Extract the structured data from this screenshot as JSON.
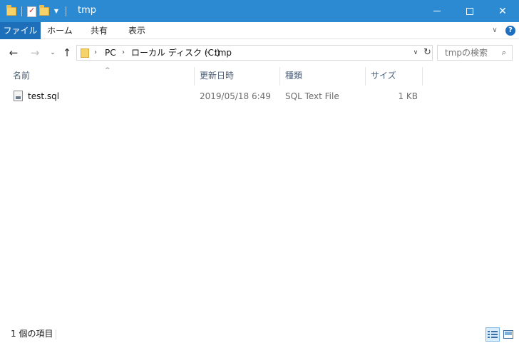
{
  "window": {
    "title": "tmp",
    "minimize_icon": "minimize-icon",
    "maximize_icon": "maximize-icon",
    "close_glyph": "✕"
  },
  "ribbon": {
    "tabs": [
      {
        "label": "ファイル"
      },
      {
        "label": "ホーム"
      },
      {
        "label": "共有"
      },
      {
        "label": "表示"
      }
    ],
    "chevron_glyph": "∨",
    "help_glyph": "?"
  },
  "navigation": {
    "back_glyph": "←",
    "forward_glyph": "→",
    "recent_glyph": "⌄",
    "up_glyph": "↑",
    "breadcrumbs": [
      "PC",
      "ローカル ディスク (C:)",
      "tmp"
    ],
    "separator": "›",
    "dropdown_glyph": "∨",
    "refresh_glyph": "↻"
  },
  "search": {
    "placeholder": "tmpの検索",
    "icon_glyph": "⌕"
  },
  "columns": {
    "name": "名前",
    "date": "更新日時",
    "type": "種類",
    "size": "サイズ",
    "sort_glyph": "^"
  },
  "files": [
    {
      "name": "test.sql",
      "modified": "2019/05/18 6:49",
      "type": "SQL Text File",
      "size": "1 KB"
    }
  ],
  "status": {
    "item_count": "1 個の項目"
  },
  "colors": {
    "titlebar": "#2b8ad2",
    "file_tab": "#1e6fba",
    "header_text": "#4c607a"
  }
}
